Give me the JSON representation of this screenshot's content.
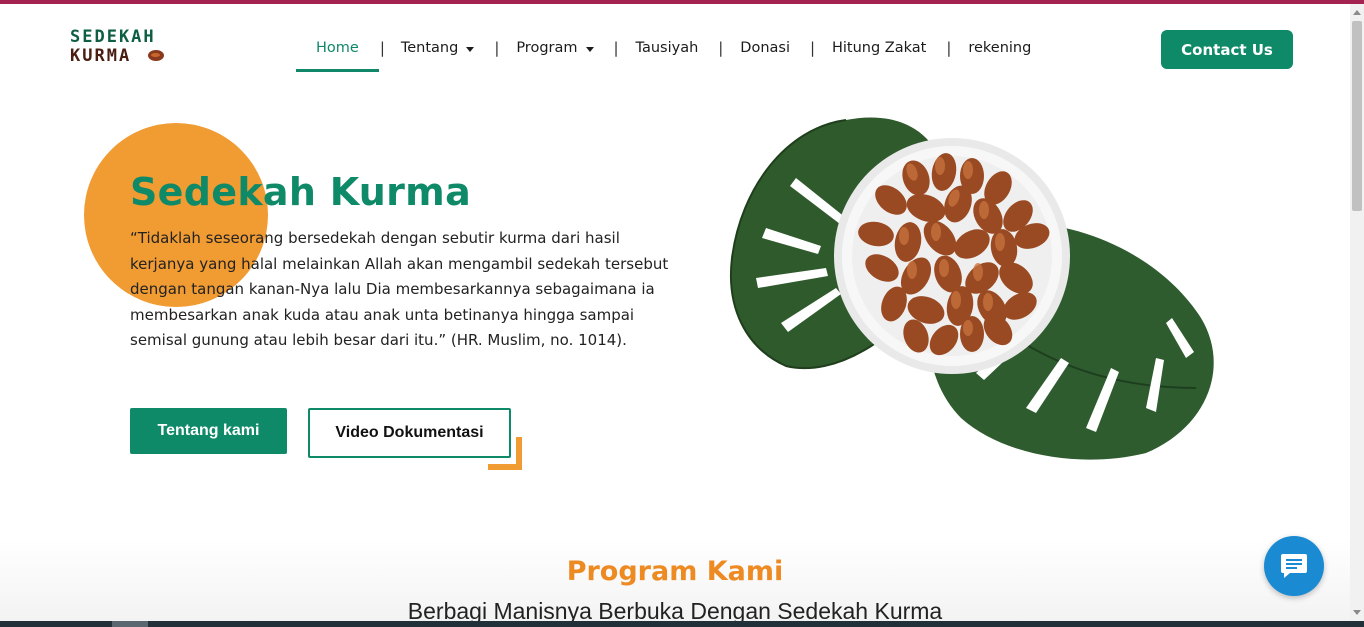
{
  "header": {
    "logo_line1": "SEDEKAH",
    "logo_line2": "KURMA",
    "nav": [
      {
        "label": "Home",
        "active": true
      },
      {
        "label": "Tentang",
        "dropdown": true
      },
      {
        "label": "Program",
        "dropdown": true
      },
      {
        "label": "Tausiyah"
      },
      {
        "label": "Donasi"
      },
      {
        "label": "Hitung Zakat"
      },
      {
        "label": "rekening"
      }
    ],
    "separator": "|",
    "contact_label": "Contact Us"
  },
  "hero": {
    "title": "Sedekah Kurma",
    "quote": "“Tidaklah seseorang bersedekah dengan sebutir kurma dari hasil kerjanya yang halal melainkan Allah akan mengambil sedekah tersebut dengan tangan kanan-Nya lalu Dia membesarkannya sebagaimana ia membesarkan anak kuda atau anak unta betinanya hingga sampai semisal gunung atau lebih besar dari itu.” (HR. Muslim, no. 1014).",
    "btn_about": "Tentang kami",
    "btn_video": "Video Dokumentasi"
  },
  "program": {
    "title": "Program Kami",
    "subtitle": "Berbagi Manisnya Berbuka Dengan Sedekah Kurma"
  },
  "icons": {
    "chat": "chat-bubble-icon",
    "caret": "caret-down-icon"
  },
  "colors": {
    "primary": "#0f8a68",
    "accent": "#f19b33",
    "program_title": "#ee8a22",
    "chat": "#1a8ad3"
  }
}
